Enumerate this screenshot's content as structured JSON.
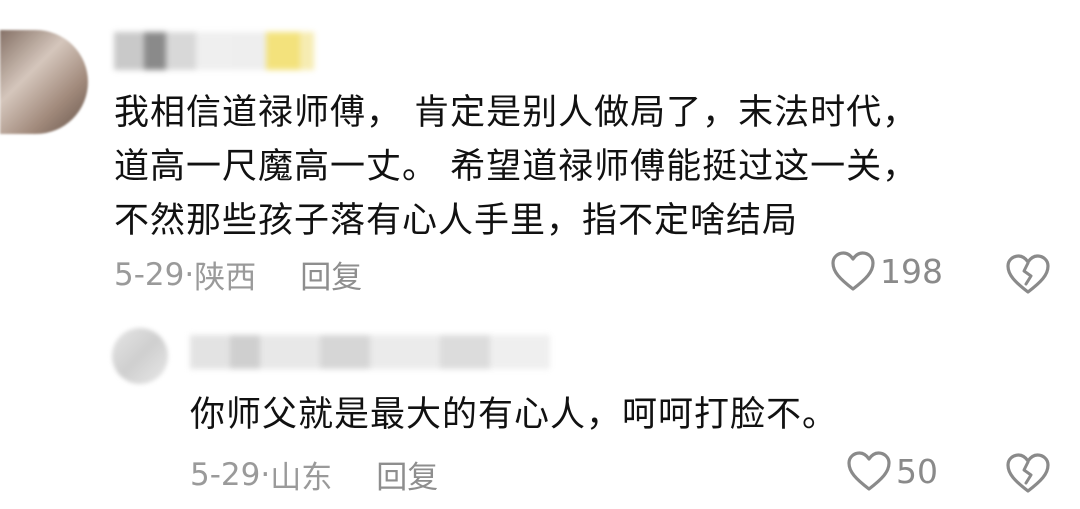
{
  "comment": {
    "lines": [
      "我相信道禄师傅， 肯定是别人做局了，末法时代，",
      "道高一尺魔高一丈。 希望道禄师傅能挺过这一关，",
      "不然那些孩子落有心人手里，指不定啥结局"
    ],
    "date": "5-29",
    "separator": "·",
    "location": "陕西",
    "reply_label": "回复",
    "like_count": "198"
  },
  "reply": {
    "text": "你师父就是最大的有心人，呵呵打脸不。",
    "date": "5-29",
    "separator": "·",
    "location": "山东",
    "reply_label": "回复",
    "like_count": "50"
  },
  "colors": {
    "meta": "#9a9a9a",
    "text": "#111111",
    "icon": "#8a8a8a"
  },
  "icons": {
    "like": "heart-outline-icon",
    "dislike": "broken-heart-icon"
  }
}
